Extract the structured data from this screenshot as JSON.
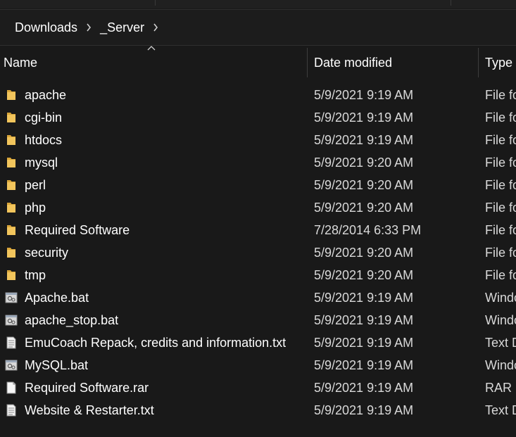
{
  "breadcrumb": {
    "items": [
      {
        "label": "Downloads"
      },
      {
        "label": "_Server"
      }
    ]
  },
  "columns": {
    "name": "Name",
    "date": "Date modified",
    "type": "Type"
  },
  "colors": {
    "background": "#191919",
    "folder": "#f2c55c",
    "text": "#ffffff"
  },
  "files": [
    {
      "name": "apache",
      "date": "5/9/2021 9:19 AM",
      "type": "File fo",
      "icon": "folder-icon"
    },
    {
      "name": "cgi-bin",
      "date": "5/9/2021 9:19 AM",
      "type": "File fo",
      "icon": "folder-icon"
    },
    {
      "name": "htdocs",
      "date": "5/9/2021 9:19 AM",
      "type": "File fo",
      "icon": "folder-icon"
    },
    {
      "name": "mysql",
      "date": "5/9/2021 9:20 AM",
      "type": "File fo",
      "icon": "folder-icon"
    },
    {
      "name": "perl",
      "date": "5/9/2021 9:20 AM",
      "type": "File fo",
      "icon": "folder-icon"
    },
    {
      "name": "php",
      "date": "5/9/2021 9:20 AM",
      "type": "File fo",
      "icon": "folder-icon"
    },
    {
      "name": "Required Software",
      "date": "7/28/2014 6:33 PM",
      "type": "File fo",
      "icon": "folder-icon"
    },
    {
      "name": "security",
      "date": "5/9/2021 9:20 AM",
      "type": "File fo",
      "icon": "folder-icon"
    },
    {
      "name": "tmp",
      "date": "5/9/2021 9:20 AM",
      "type": "File fo",
      "icon": "folder-icon"
    },
    {
      "name": "Apache.bat",
      "date": "5/9/2021 9:19 AM",
      "type": "Windo",
      "icon": "batch-file-icon"
    },
    {
      "name": "apache_stop.bat",
      "date": "5/9/2021 9:19 AM",
      "type": "Windo",
      "icon": "batch-file-icon"
    },
    {
      "name": "EmuCoach Repack, credits and information.txt",
      "date": "5/9/2021 9:19 AM",
      "type": "Text D",
      "icon": "text-file-icon"
    },
    {
      "name": "MySQL.bat",
      "date": "5/9/2021 9:19 AM",
      "type": "Windo",
      "icon": "batch-file-icon"
    },
    {
      "name": "Required Software.rar",
      "date": "5/9/2021 9:19 AM",
      "type": "RAR F",
      "icon": "archive-file-icon"
    },
    {
      "name": "Website & Restarter.txt",
      "date": "5/9/2021 9:19 AM",
      "type": "Text D",
      "icon": "text-file-icon"
    }
  ]
}
